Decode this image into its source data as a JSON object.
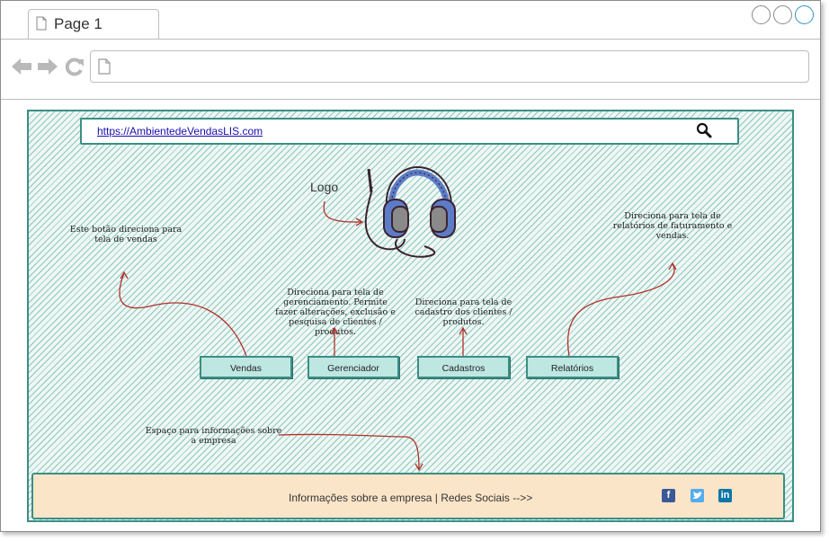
{
  "browser": {
    "tab_title": "Page 1",
    "url": ""
  },
  "page": {
    "address_link": "https://AmbientedeVendasLIS.com",
    "logo_label": "Logo",
    "notes": {
      "vendas": "Este botão direciona para tela de vendas",
      "gerenciador": "Direciona para tela de gerenciamento. Permite fazer alterações, exclusão e pesquisa de clientes / produtos.",
      "cadastros": "Direciona para tela de cadastro dos clientes / produtos.",
      "relatorios": "Direciona para tela de relatórios de faturamento e vendas.",
      "empresa": "Espaço para informações sobre a empresa"
    },
    "buttons": {
      "vendas": "Vendas",
      "gerenciador": "Gerenciador",
      "cadastros": "Cadastros",
      "relatorios": "Relatórios"
    },
    "footer": {
      "text": "Informações sobre a empresa | Redes Sociais -->>",
      "social": [
        "facebook-icon",
        "twitter-icon",
        "linkedin-icon"
      ]
    }
  },
  "colors": {
    "accent": "#3a8f85",
    "button_fill": "#bfe7e2",
    "footer_fill": "#fbe5c8",
    "arrow": "#b3302a"
  }
}
